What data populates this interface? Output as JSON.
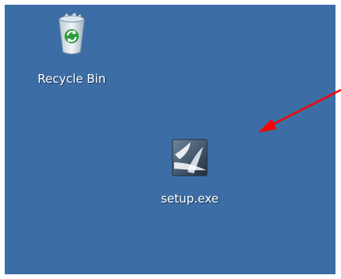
{
  "desktop": {
    "background_color": "#3c6ea5",
    "icons": [
      {
        "label": "Recycle Bin",
        "icon": "recycle-bin-icon"
      },
      {
        "label": "setup.exe",
        "icon": "setup-exe-icon"
      }
    ]
  },
  "annotation": {
    "type": "arrow",
    "color": "#ff0000",
    "points_to": "setup.exe"
  }
}
